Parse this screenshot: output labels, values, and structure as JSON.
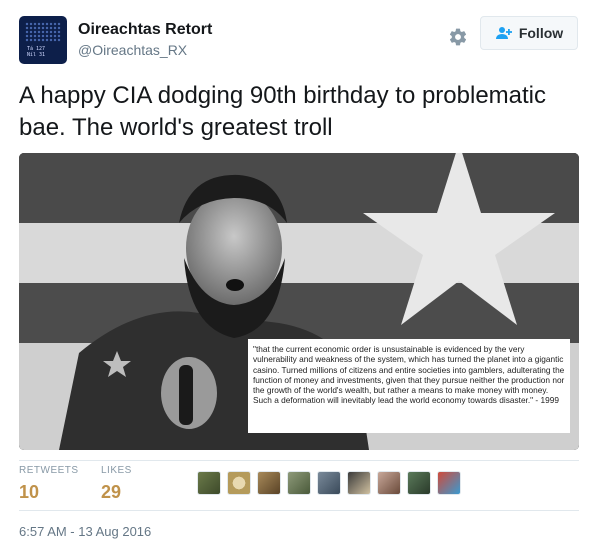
{
  "account": {
    "display_name": "Oireachtas Retort",
    "handle": "@Oireachtas_RX",
    "avatar_score_lines": [
      "Tá  127",
      "Níl  31"
    ]
  },
  "actions": {
    "settings_icon": "gear-icon",
    "follow_label": "Follow",
    "follow_icon": "add-user-icon"
  },
  "tweet": {
    "text": "A happy CIA dodging 90th birthday to problematic bae. The world's greatest troll"
  },
  "media": {
    "quote": "\"that the current economic order is unsustainable is evidenced by the very vulnerability and weakness of the system, which has turned the planet into a gigantic casino. Turned millions of citizens and entire societies into gamblers, adulterating the function of money and investments, given that they pursue neither the production nor the growth of the world's wealth, but rather a means to make money with money. Such a deformation will inevitably lead the world economy towards disaster.\" - 1999"
  },
  "stats": {
    "retweets_label": "RETWEETS",
    "retweets_value": "10",
    "likes_label": "LIKES",
    "likes_value": "29",
    "likers_count": 9
  },
  "timestamp": "6:57 AM - 13 Aug 2016",
  "colors": {
    "stat_value": "#c0924a",
    "muted": "#657786",
    "follow_icon": "#1da1f2"
  }
}
